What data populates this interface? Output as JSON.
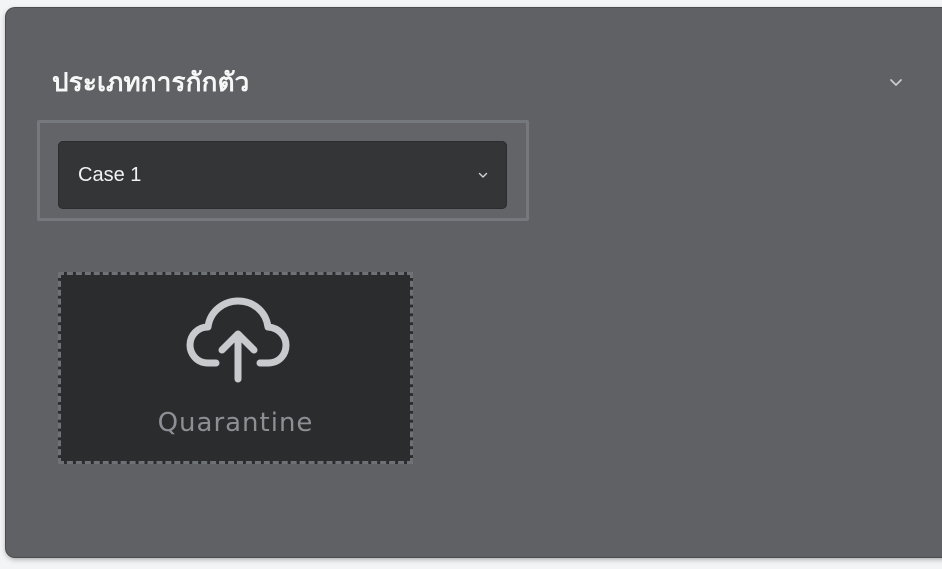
{
  "section": {
    "title": "ประเภทการกักตัว",
    "collapse_icon": "chevron-down-icon"
  },
  "case_select": {
    "selected": "Case 1",
    "icon": "chevron-down-icon"
  },
  "upload": {
    "label": "Quarantine",
    "icon": "cloud-upload-icon"
  },
  "colors": {
    "panel_bg": "#5f6164",
    "select_bg": "#343537",
    "tile_bg": "#2b2c2e",
    "title_text": "#f7f7f7",
    "muted_text": "#8c8f93"
  }
}
